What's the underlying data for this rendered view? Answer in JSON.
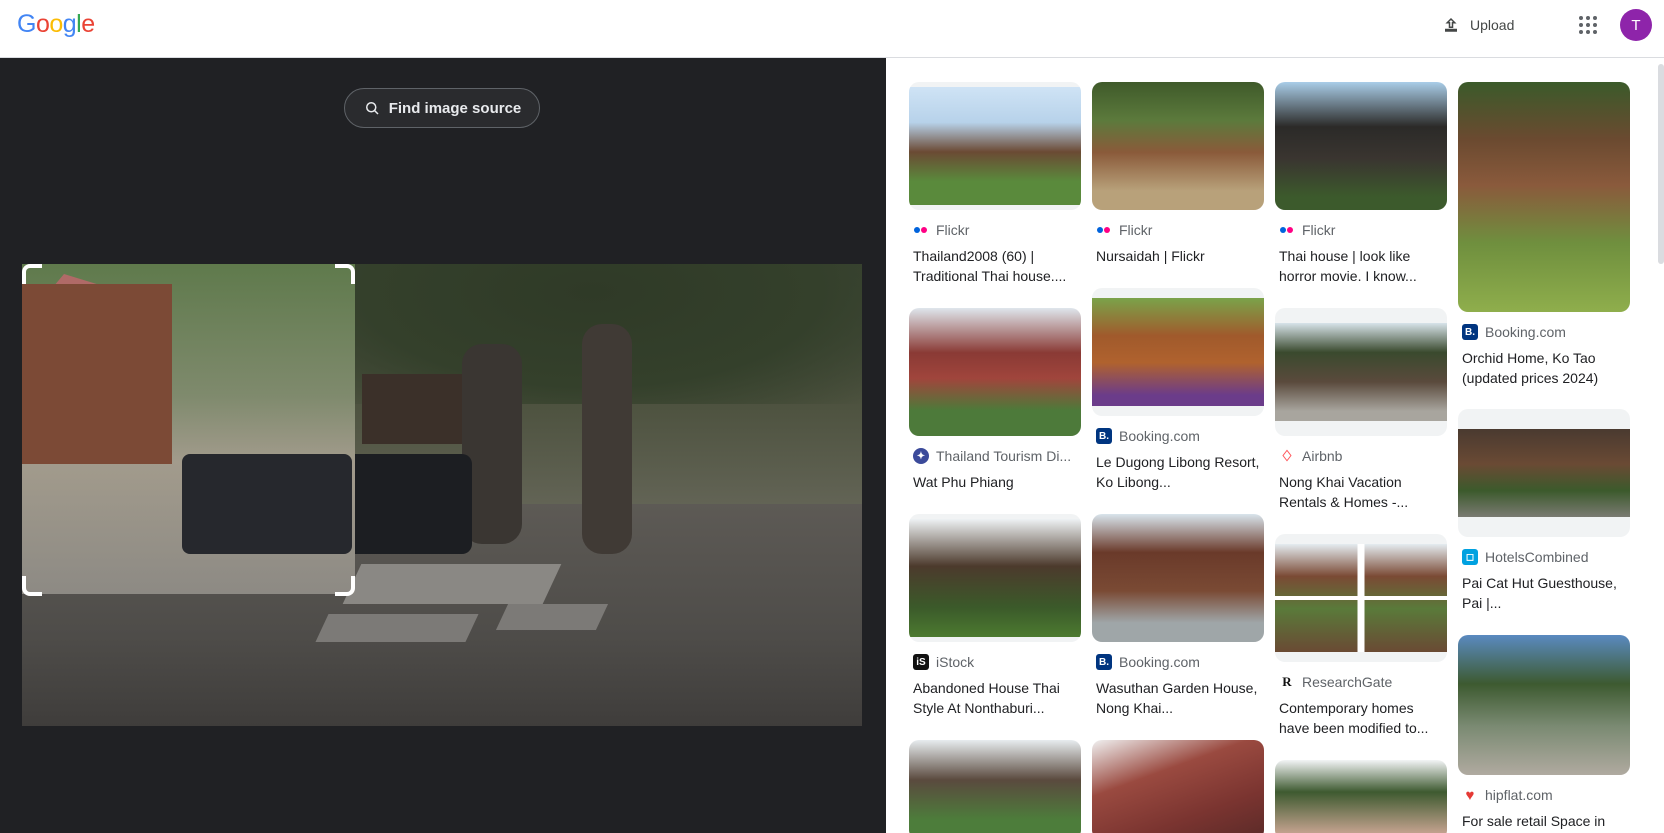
{
  "header": {
    "logo": "Google",
    "upload_label": "Upload",
    "avatar_letter": "T"
  },
  "left": {
    "find_source_label": "Find image source"
  },
  "colors": {
    "dark_bg": "#202124",
    "avatar": "#8e24aa",
    "flickr_pink": "#ff0084",
    "flickr_blue": "#0063dc",
    "booking_blue": "#003580"
  },
  "results": [
    {
      "source": "Flickr",
      "icon": "flickr-icon",
      "title": "Thailand2008 (60) | Traditional Thai house...."
    },
    {
      "source": "Flickr",
      "icon": "flickr-icon",
      "title": "Nursaidah | Flickr"
    },
    {
      "source": "Flickr",
      "icon": "flickr-icon",
      "title": "Thai house | look like horror movie. I know..."
    },
    {
      "source": "Booking.com",
      "icon": "booking-icon",
      "title": "Orchid Home, Ko Tao (updated prices 2024)"
    },
    {
      "source": "Thailand Tourism Di...",
      "icon": "tourism-icon",
      "title": "Wat Phu Phiang"
    },
    {
      "source": "Booking.com",
      "icon": "booking-icon",
      "title": "Le Dugong Libong Resort, Ko Libong..."
    },
    {
      "source": "Airbnb",
      "icon": "airbnb-icon",
      "title": "Nong Khai Vacation Rentals & Homes -..."
    },
    {
      "source": "HotelsCombined",
      "icon": "hotelscombined-icon",
      "title": "Pai Cat Hut Guesthouse, Pai |..."
    },
    {
      "source": "iStock",
      "icon": "istock-icon",
      "title": "Abandoned House Thai Style At Nonthaburi..."
    },
    {
      "source": "Booking.com",
      "icon": "booking-icon",
      "title": "Wasuthan Garden House, Nong Khai..."
    },
    {
      "source": "ResearchGate",
      "icon": "researchgate-icon",
      "title": "Contemporary homes have been modified to..."
    },
    {
      "source": "hipflat.com",
      "icon": "hipflat-icon",
      "title": "For sale retail Space in"
    }
  ]
}
